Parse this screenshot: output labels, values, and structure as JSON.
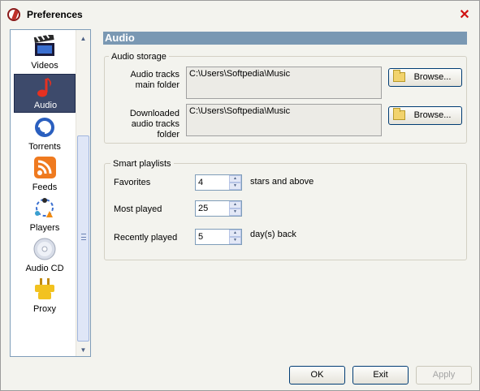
{
  "window": {
    "title": "Preferences"
  },
  "sidebar": {
    "items": [
      {
        "label": "Videos",
        "icon": "clapperboard-icon"
      },
      {
        "label": "Audio",
        "icon": "music-note-icon",
        "selected": true
      },
      {
        "label": "Torrents",
        "icon": "torrent-icon"
      },
      {
        "label": "Feeds",
        "icon": "rss-icon"
      },
      {
        "label": "Players",
        "icon": "players-icon"
      },
      {
        "label": "Audio CD",
        "icon": "cd-icon"
      },
      {
        "label": "Proxy",
        "icon": "plug-icon"
      }
    ]
  },
  "main": {
    "header": "Audio",
    "storage": {
      "title": "Audio storage",
      "tracks_label_1": "Audio tracks",
      "tracks_label_2": "main folder",
      "tracks_path": "C:\\Users\\Softpedia\\Music",
      "downloaded_label_1": "Downloaded",
      "downloaded_label_2": "audio tracks",
      "downloaded_label_3": "folder",
      "downloaded_path": "C:\\Users\\Softpedia\\Music",
      "browse_label": "Browse..."
    },
    "playlists": {
      "title": "Smart playlists",
      "favorites_label": "Favorites",
      "favorites_value": "4",
      "favorites_suffix": "stars and above",
      "most_played_label": "Most played",
      "most_played_value": "25",
      "recently_played_label": "Recently played",
      "recently_played_value": "5",
      "recently_played_suffix": "day(s) back"
    }
  },
  "footer": {
    "ok": "OK",
    "exit": "Exit",
    "apply": "Apply"
  }
}
